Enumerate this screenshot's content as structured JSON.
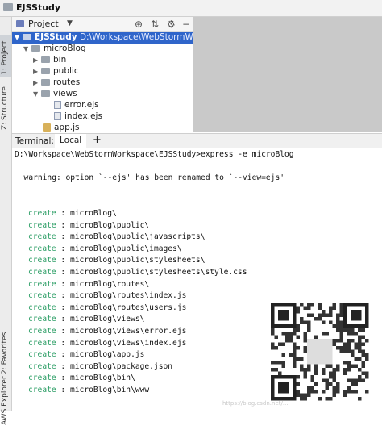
{
  "window": {
    "title": "EJSStudy"
  },
  "sidebar": {
    "tabs": [
      {
        "label": "1: Project"
      },
      {
        "label": "Z: Structure"
      },
      {
        "label": "2: Favorites"
      },
      {
        "label": "AWS Explorer"
      }
    ]
  },
  "project": {
    "header_label": "Project",
    "tree": {
      "root": {
        "name": "EJSStudy",
        "path": "D:\\Workspace\\WebStormWorkspace\\EJ"
      },
      "items": [
        {
          "name": "microBlog"
        },
        {
          "name": "bin"
        },
        {
          "name": "public"
        },
        {
          "name": "routes"
        },
        {
          "name": "views"
        },
        {
          "name": "error.ejs"
        },
        {
          "name": "index.ejs"
        },
        {
          "name": "app.js"
        }
      ]
    }
  },
  "terminal": {
    "label": "Terminal:",
    "tab": "Local",
    "add": "+",
    "command_line": "D:\\Workspace\\WebStormWorkspace\\EJSStudy>express -e microBlog",
    "warning": "  warning: option `--ejs' has been renamed to `--view=ejs'",
    "create_keyword": "create",
    "sep": " : ",
    "paths": [
      "microBlog\\",
      "microBlog\\public\\",
      "microBlog\\public\\javascripts\\",
      "microBlog\\public\\images\\",
      "microBlog\\public\\stylesheets\\",
      "microBlog\\public\\stylesheets\\style.css",
      "microBlog\\routes\\",
      "microBlog\\routes\\index.js",
      "microBlog\\routes\\users.js",
      "microBlog\\views\\",
      "microBlog\\views\\error.ejs",
      "microBlog\\views\\index.ejs",
      "microBlog\\app.js",
      "microBlog\\package.json",
      "microBlog\\bin\\",
      "microBlog\\bin\\www"
    ]
  },
  "watermark": "https://blog.csdn.net/..."
}
